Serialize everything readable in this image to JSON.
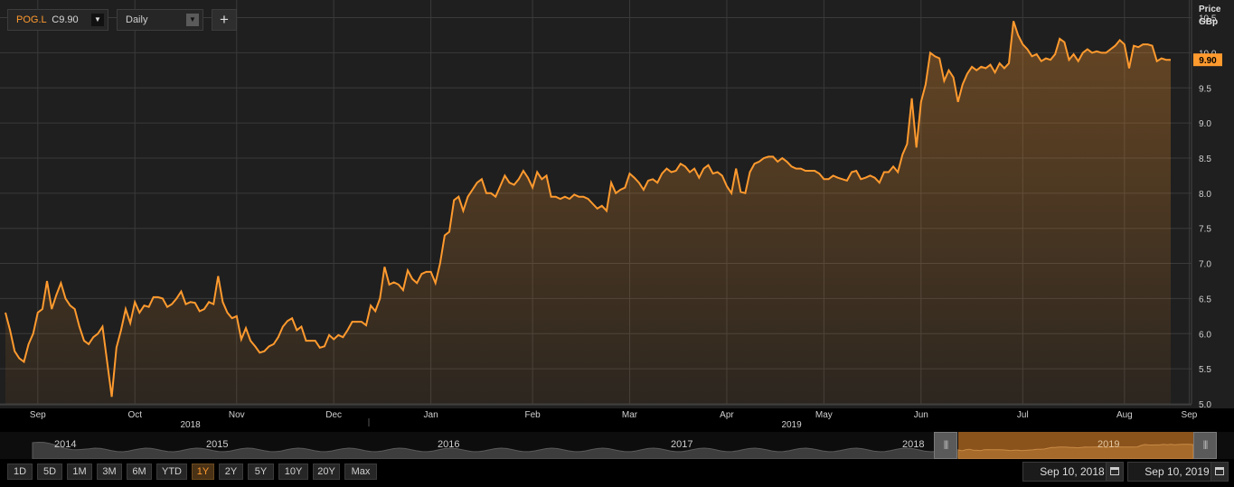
{
  "toolbar": {
    "symbol": "POG.L",
    "close_prefix": "C",
    "close_value": "9.90",
    "period": "Daily",
    "add_label": "+"
  },
  "chart_data": {
    "type": "area",
    "series": [
      {
        "values": [
          6.3,
          6.05,
          5.75,
          5.65,
          5.6,
          5.85,
          6.0,
          6.3,
          6.35,
          6.75,
          6.35,
          6.55,
          6.72,
          6.5,
          6.4,
          6.35,
          6.1,
          5.9,
          5.85,
          5.95,
          6.0,
          6.1,
          5.6,
          5.1,
          5.8,
          6.05,
          6.35,
          6.15,
          6.45,
          6.3,
          6.4,
          6.38,
          6.52,
          6.52,
          6.5,
          6.38,
          6.42,
          6.5,
          6.6,
          6.42,
          6.45,
          6.44,
          6.32,
          6.35,
          6.45,
          6.42,
          6.82,
          6.45,
          6.3,
          6.22,
          6.25,
          5.92,
          6.08,
          5.9,
          5.82,
          5.73,
          5.75,
          5.82,
          5.85,
          5.95,
          6.1,
          6.18,
          6.22,
          6.05,
          6.1,
          5.9,
          5.9,
          5.9,
          5.8,
          5.82,
          5.98,
          5.92,
          5.98,
          5.95,
          6.05,
          6.17,
          6.17,
          6.17,
          6.12,
          6.4,
          6.32,
          6.5,
          6.95,
          6.7,
          6.73,
          6.7,
          6.62,
          6.9,
          6.78,
          6.72,
          6.85,
          6.88,
          6.88,
          6.72,
          7.0,
          7.4,
          7.45,
          7.9,
          7.95,
          7.75,
          7.95,
          8.05,
          8.15,
          8.2,
          8.0,
          8.0,
          7.95,
          8.1,
          8.25,
          8.15,
          8.12,
          8.2,
          8.32,
          8.22,
          8.08,
          8.3,
          8.2,
          8.25,
          7.95,
          7.95,
          7.92,
          7.95,
          7.92,
          7.98,
          7.95,
          7.95,
          7.92,
          7.85,
          7.78,
          7.82,
          7.75,
          8.15,
          8.0,
          8.05,
          8.08,
          8.28,
          8.22,
          8.15,
          8.05,
          8.18,
          8.2,
          8.15,
          8.28,
          8.35,
          8.3,
          8.32,
          8.42,
          8.38,
          8.3,
          8.35,
          8.22,
          8.35,
          8.4,
          8.28,
          8.3,
          8.25,
          8.1,
          8.0,
          8.35,
          8.02,
          8.0,
          8.3,
          8.42,
          8.45,
          8.5,
          8.52,
          8.52,
          8.45,
          8.5,
          8.45,
          8.38,
          8.35,
          8.35,
          8.32,
          8.32,
          8.32,
          8.28,
          8.2,
          8.2,
          8.25,
          8.22,
          8.2,
          8.18,
          8.3,
          8.32,
          8.2,
          8.22,
          8.25,
          8.22,
          8.15,
          8.3,
          8.3,
          8.38,
          8.3,
          8.55,
          8.7,
          9.35,
          8.65,
          9.3,
          9.55,
          10.0,
          9.95,
          9.92,
          9.6,
          9.75,
          9.65,
          9.3,
          9.55,
          9.7,
          9.8,
          9.75,
          9.8,
          9.78,
          9.83,
          9.72,
          9.85,
          9.78,
          9.85,
          10.45,
          10.25,
          10.12,
          10.05,
          9.95,
          9.98,
          9.88,
          9.92,
          9.9,
          9.98,
          10.2,
          10.15,
          9.9,
          9.98,
          9.88,
          10.0,
          10.05,
          10.0,
          10.02,
          10.0,
          10.0,
          10.05,
          10.1,
          10.18,
          10.12,
          9.78,
          10.1,
          10.08,
          10.12,
          10.12,
          10.1,
          9.88,
          9.92,
          9.9,
          9.9
        ]
      }
    ],
    "y_title_line1": "Price",
    "y_title_line2": "GBp",
    "ylim": [
      5.0,
      10.7
    ],
    "y_ticks": [
      "5.0",
      "5.5",
      "6.0",
      "6.5",
      "7.0",
      "7.5",
      "8.0",
      "8.5",
      "9.0",
      "9.5",
      "10.0",
      "10.5"
    ],
    "month_labels": [
      {
        "label": "Sep",
        "idx": 7
      },
      {
        "label": "Oct",
        "idx": 28
      },
      {
        "label": "Nov",
        "idx": 50
      },
      {
        "label": "Dec",
        "idx": 71
      },
      {
        "label": "Jan",
        "idx": 92
      },
      {
        "label": "Feb",
        "idx": 114
      },
      {
        "label": "Mar",
        "idx": 135
      },
      {
        "label": "Apr",
        "idx": 156
      },
      {
        "label": "May",
        "idx": 177
      },
      {
        "label": "Jun",
        "idx": 198
      },
      {
        "label": "Jul",
        "idx": 220
      },
      {
        "label": "Aug",
        "idx": 242
      },
      {
        "label": "Sep",
        "idx": 256
      }
    ],
    "year_labels": [
      {
        "label": "2018",
        "idx": 40
      },
      {
        "label": "2019",
        "idx": 170
      }
    ],
    "last_value_label": "9.90",
    "grid": true,
    "colors": {
      "line": "#ff9a2e",
      "grid": "#3a3a3a",
      "label_bg": "#ff9a2e"
    }
  },
  "navigator": {
    "years": [
      "2014",
      "2015",
      "2016",
      "2017",
      "2018",
      "2019"
    ]
  },
  "range_buttons": [
    "1D",
    "5D",
    "1M",
    "3M",
    "6M",
    "YTD",
    "1Y",
    "2Y",
    "5Y",
    "10Y",
    "20Y",
    "Max"
  ],
  "active_range": "1Y",
  "date_from": "Sep 10, 2018",
  "date_to": "Sep 10, 2019"
}
